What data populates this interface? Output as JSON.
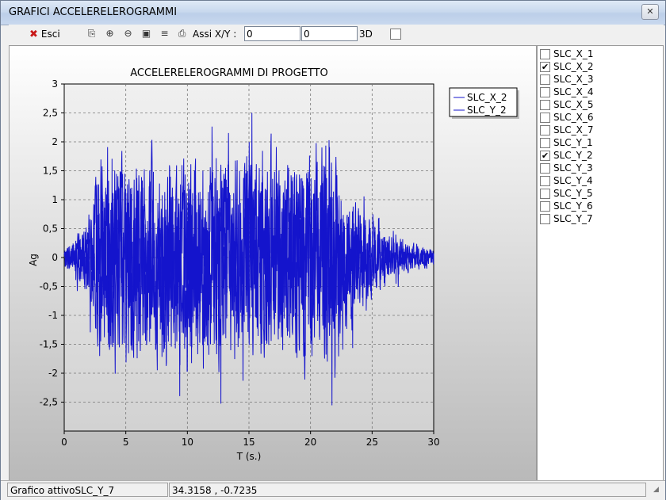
{
  "window": {
    "title": "GRAFICI ACCELERELEROGRAMMI",
    "close_icon": "close-icon"
  },
  "toolbar": {
    "exit_label": "Esci",
    "axes_label": "Assi X/Y :",
    "x_value": "0",
    "y_value": "0",
    "label_3d": "3D",
    "checkbox_3d_checked": false,
    "icons": [
      "copy-icon",
      "zoom-in-icon",
      "zoom-out-icon",
      "save-icon",
      "export-icon",
      "print-icon"
    ]
  },
  "chart_data": {
    "type": "line",
    "title": "ACCELERELEROGRAMMI DI PROGETTO",
    "xlabel": "T (s.)",
    "ylabel": "Ag",
    "xlim": [
      0,
      30
    ],
    "ylim": [
      -3,
      3
    ],
    "x_ticks": [
      "0",
      "5",
      "10",
      "15",
      "20",
      "25",
      "30"
    ],
    "y_ticks": [
      "-2,5",
      "-2",
      "-1,5",
      "-1",
      "-0,5",
      "0",
      "0,5",
      "1",
      "1,5",
      "2",
      "2,5",
      "3"
    ],
    "grid": true,
    "legend_position": "top-right",
    "color": "#1414cc",
    "series": [
      {
        "name": "SLC_X_2",
        "duration": 30
      },
      {
        "name": "SLC_Y_2",
        "duration": 30
      }
    ]
  },
  "series_list": [
    {
      "label": "SLC_X_1",
      "checked": false
    },
    {
      "label": "SLC_X_2",
      "checked": true
    },
    {
      "label": "SLC_X_3",
      "checked": false
    },
    {
      "label": "SLC_X_4",
      "checked": false
    },
    {
      "label": "SLC_X_5",
      "checked": false
    },
    {
      "label": "SLC_X_6",
      "checked": false
    },
    {
      "label": "SLC_X_7",
      "checked": false
    },
    {
      "label": "SLC_Y_1",
      "checked": false
    },
    {
      "label": "SLC_Y_2",
      "checked": true
    },
    {
      "label": "SLC_Y_3",
      "checked": false
    },
    {
      "label": "SLC_Y_4",
      "checked": false
    },
    {
      "label": "SLC_Y_5",
      "checked": false
    },
    {
      "label": "SLC_Y_6",
      "checked": false
    },
    {
      "label": "SLC_Y_7",
      "checked": false
    }
  ],
  "status": {
    "active_chart": "Grafico attivoSLC_Y_7",
    "coordinates": "34.3158 , -0.7235"
  }
}
